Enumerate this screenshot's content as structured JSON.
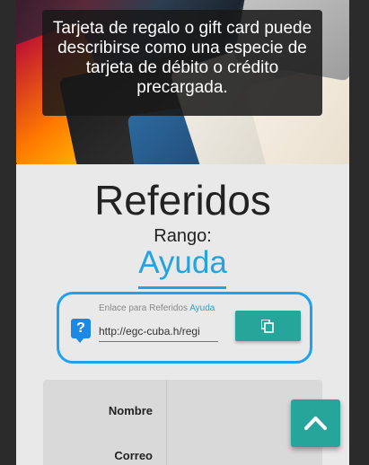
{
  "hero": {
    "caption": "Tarjeta de regalo o gift card puede describirse como una especie de tarjeta de débito o crédito precargada."
  },
  "main": {
    "title": "Referidos",
    "rango_label": "Rango:",
    "rango_value": "Ayuda"
  },
  "referral": {
    "label": "Enlace para Referidos",
    "help_link": "Ayuda",
    "url_value": "http://egc-cuba.h/regi",
    "copy_icon": "copy-icon",
    "help_icon": "question-icon"
  },
  "table": {
    "rows": [
      {
        "label": "Nombre"
      },
      {
        "label": "Correo"
      }
    ]
  },
  "fab": {
    "icon": "chevron-up-icon"
  },
  "colors": {
    "accent": "#23a3e0",
    "teal": "#26a69a",
    "highlight_border": "#1da1f2"
  }
}
